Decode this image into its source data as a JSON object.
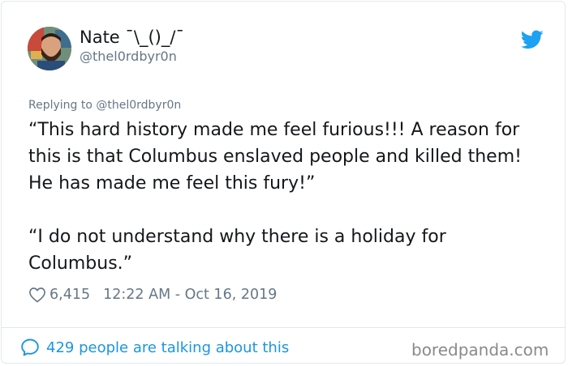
{
  "author": {
    "name": "Nate ¯\\_()_/¯",
    "handle": "@thel0rdbyr0n"
  },
  "reply": {
    "text": "Replying to @thel0rdbyr0n"
  },
  "tweet": {
    "paragraph1": "“This hard history made me feel furious!!! A reason for this is that Columbus enslaved people and killed them! He has made me feel this fury!”",
    "paragraph2": "“I do not understand why there is a holiday for Columbus.”"
  },
  "meta": {
    "likes": "6,415",
    "timestamp": "12:22 AM - Oct 16, 2019"
  },
  "footer": {
    "talking": "429 people are talking about this",
    "watermark": "boredpanda.com"
  },
  "colors": {
    "twitter_blue": "#1da1f2",
    "link_blue": "#1b95e0",
    "secondary_text": "#657786"
  },
  "icons": {
    "brand": "twitter-bird-icon",
    "like": "heart-icon",
    "comment": "speech-bubble-icon"
  }
}
